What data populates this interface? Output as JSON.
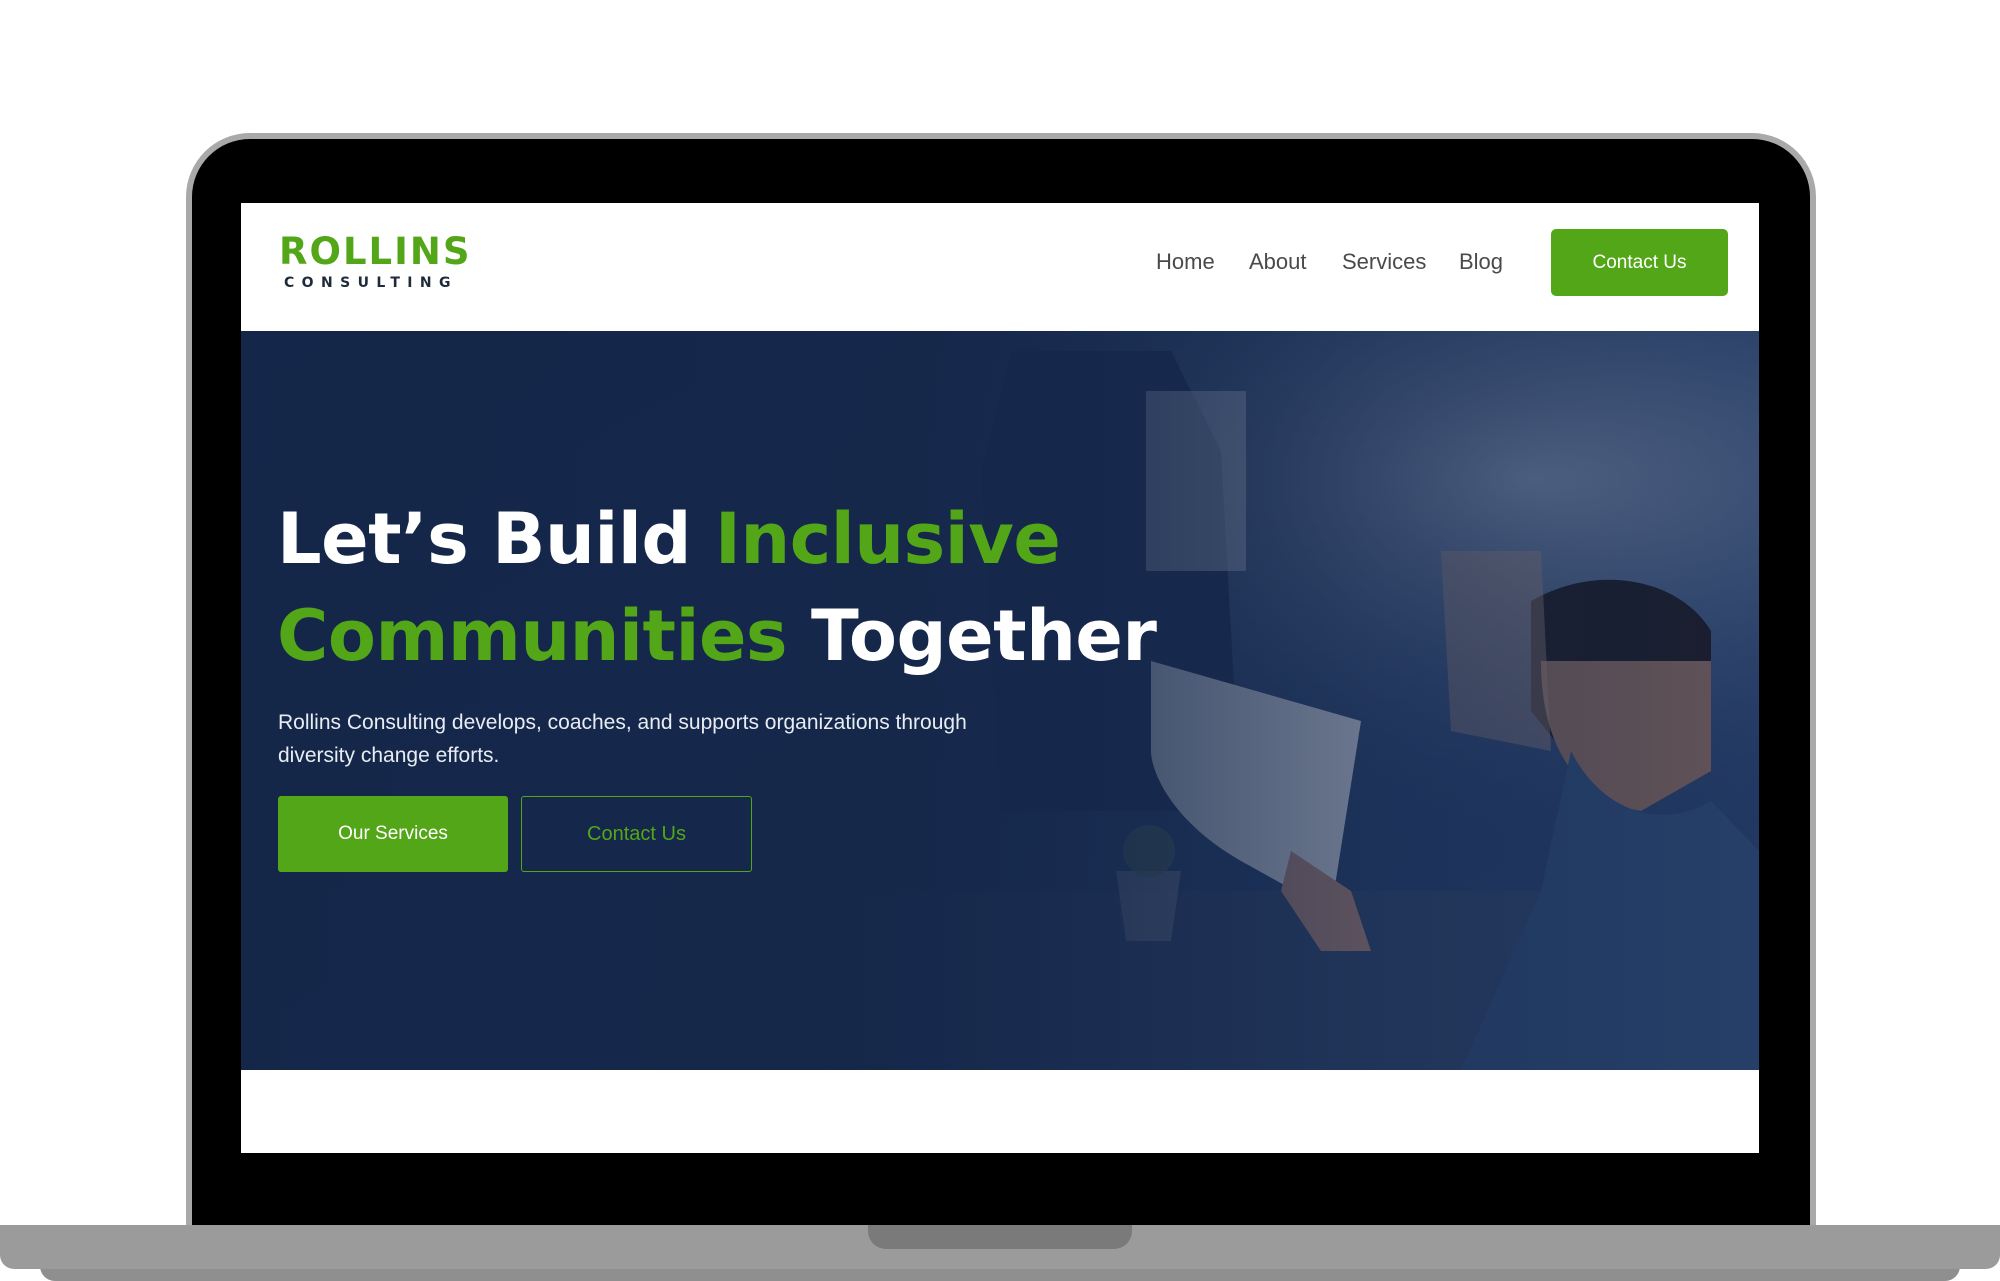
{
  "brand": {
    "name": "ROLLINS",
    "tagline": "CONSULTING",
    "accent_color": "#52a617",
    "dark_color": "#1f2b3a"
  },
  "nav": {
    "items": [
      {
        "label": "Home"
      },
      {
        "label": "About"
      },
      {
        "label": "Services"
      },
      {
        "label": "Blog"
      }
    ],
    "cta_label": "Contact Us"
  },
  "hero": {
    "title_part1": "Let’s Build ",
    "title_accent1": "Inclusive",
    "title_accent2": "Communities",
    "title_part2": " Together",
    "description": "Rollins Consulting develops, coaches, and supports organizations through diversity change efforts.",
    "primary_button": "Our Services",
    "secondary_button": "Contact Us",
    "overlay_color": "#142648"
  }
}
